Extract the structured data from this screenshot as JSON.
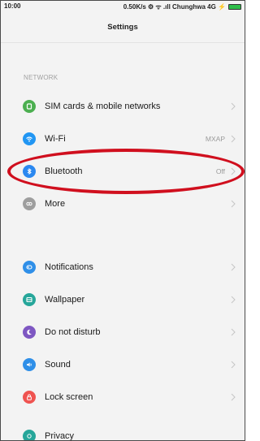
{
  "status": {
    "time": "10:00",
    "right_text": "0.50K/s ⚙ ᯤ .ıll Chunghwa 4G ⚡"
  },
  "header": {
    "title": "Settings"
  },
  "sections": {
    "network_label": "NETWORK"
  },
  "rows": [
    {
      "label": "SIM cards & mobile networks",
      "value": "",
      "color": "#4caf50",
      "icon": "sim-icon"
    },
    {
      "label": "Wi-Fi",
      "value": "MXAP",
      "color": "#2196f3",
      "icon": "wifi-icon"
    },
    {
      "label": "Bluetooth",
      "value": "Off",
      "color": "#2b88f0",
      "icon": "bluetooth-icon"
    },
    {
      "label": "More",
      "value": "",
      "color": "#9e9e9e",
      "icon": "more-icon"
    },
    {
      "label": "Notifications",
      "value": "",
      "color": "#2f8fe8",
      "icon": "notifications-icon"
    },
    {
      "label": "Wallpaper",
      "value": "",
      "color": "#26a69a",
      "icon": "wallpaper-icon"
    },
    {
      "label": "Do not disturb",
      "value": "",
      "color": "#7e57c2",
      "icon": "moon-icon"
    },
    {
      "label": "Sound",
      "value": "",
      "color": "#2f8fe8",
      "icon": "sound-icon"
    },
    {
      "label": "Lock screen",
      "value": "",
      "color": "#ef5350",
      "icon": "lock-icon"
    },
    {
      "label": "Privacy",
      "value": "",
      "color": "#26a69a",
      "icon": "privacy-icon"
    }
  ],
  "colors": {
    "annotation": "#d00f1e"
  }
}
